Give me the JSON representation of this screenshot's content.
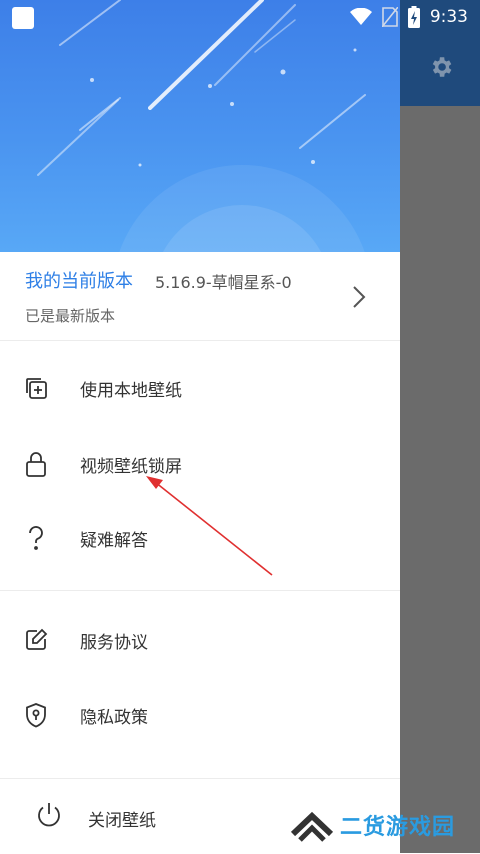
{
  "status_bar": {
    "time": "9:33"
  },
  "drawer": {
    "version": {
      "title": "我的当前版本",
      "number": "5.16.9-草帽星系-0",
      "status": "已是最新版本"
    },
    "menu": [
      {
        "label": "使用本地壁纸",
        "icon": "add-copy-icon"
      },
      {
        "label": "视频壁纸锁屏",
        "icon": "lock-icon"
      },
      {
        "label": "疑难解答",
        "icon": "question-icon"
      },
      {
        "label": "服务协议",
        "icon": "edit-document-icon"
      },
      {
        "label": "隐私政策",
        "icon": "shield-icon"
      }
    ],
    "footer": {
      "label": "关闭壁纸",
      "icon": "power-icon"
    }
  },
  "watermark": {
    "text": "二货游戏园"
  },
  "colors": {
    "accent": "#2e7fe6",
    "header_top": "#3d7fe8",
    "annotation": "#e03030"
  }
}
